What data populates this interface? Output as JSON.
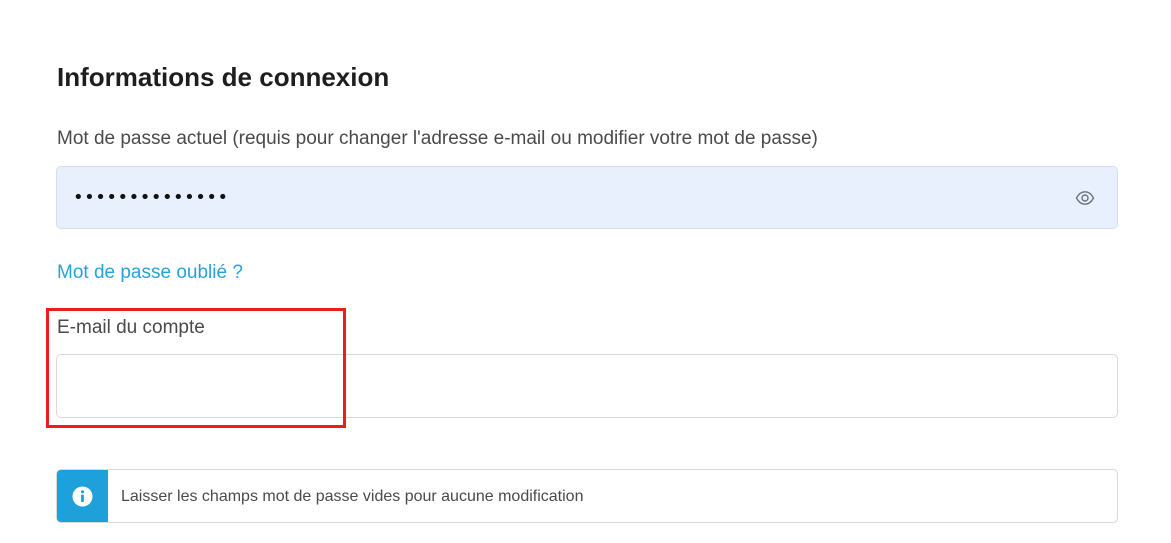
{
  "login_section": {
    "title": "Informations de connexion",
    "current_password": {
      "label": "Mot de passe actuel (requis pour changer l'adresse e-mail ou modifier votre mot de passe)",
      "value_masked": "••••••••••••••",
      "toggle_icon": "eye-icon"
    },
    "forgot_password_link": "Mot de passe oublié ?",
    "account_email": {
      "label": "E-mail du compte",
      "value": "",
      "placeholder": ""
    },
    "info_alert": {
      "icon": "info-icon",
      "text": "Laisser les champs mot de passe vides pour aucune modification"
    }
  },
  "colors": {
    "link": "#25a3d8",
    "autofill_bg": "#e8f0fe",
    "info_accent": "#1ea1db",
    "highlight": "#ee1c1c"
  }
}
